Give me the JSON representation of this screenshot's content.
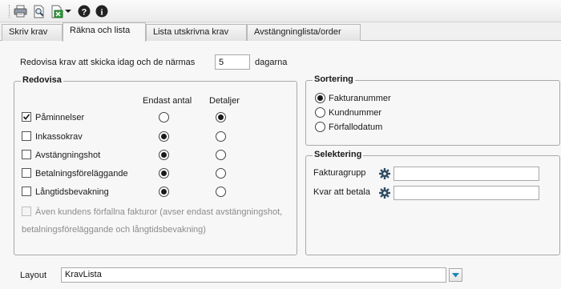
{
  "toolbar": {
    "buttons": [
      {
        "icon": "printer-icon"
      },
      {
        "icon": "print-preview-icon"
      },
      {
        "icon": "export-icon"
      },
      {
        "icon": "help-icon"
      },
      {
        "icon": "info-icon"
      }
    ]
  },
  "tabs": [
    {
      "label": "Skriv krav"
    },
    {
      "label": "Räkna och lista"
    },
    {
      "label": "Lista utskrivna krav"
    },
    {
      "label": "Avstängninglista/order"
    }
  ],
  "days": {
    "prefix": "Redovisa krav att skicka idag och de närmas",
    "value": "5",
    "suffix": "dagarna"
  },
  "redovisa": {
    "title": "Redovisa",
    "col_endast": "Endast antal",
    "col_detaljer": "Detaljer",
    "rows": [
      {
        "label": "Påminnelser",
        "checked": true,
        "selected": "detaljer"
      },
      {
        "label": "Inkassokrav",
        "checked": false,
        "selected": "endast"
      },
      {
        "label": "Avstängningshot",
        "checked": false,
        "selected": "endast"
      },
      {
        "label": "Betalningsföreläggande",
        "checked": false,
        "selected": "endast"
      },
      {
        "label": "Långtidsbevakning",
        "checked": false,
        "selected": "endast"
      }
    ],
    "even_line1": "Även kundens förfallna fakturor (avser endast avstängningshot,",
    "even_line2": "betalningsföreläggande och långtidsbevakning)"
  },
  "sortering": {
    "title": "Sortering",
    "options": [
      {
        "label": "Fakturanummer",
        "selected": true
      },
      {
        "label": "Kundnummer",
        "selected": false
      },
      {
        "label": "Förfallodatum",
        "selected": false
      }
    ]
  },
  "selektering": {
    "title": "Selektering",
    "fakturagrupp_label": "Fakturagrupp",
    "fakturagrupp_value": "",
    "kvar_label": "Kvar att betala",
    "kvar_value": ""
  },
  "layout": {
    "label": "Layout",
    "value": "KravLista"
  }
}
